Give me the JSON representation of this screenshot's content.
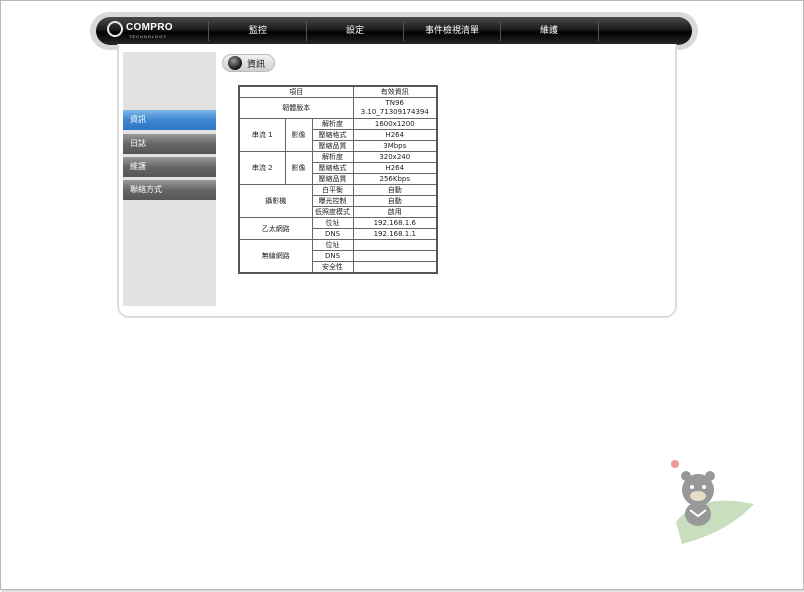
{
  "brand": {
    "name": "COMPRO",
    "sub": "TECHNOLOGY"
  },
  "nav": {
    "items": [
      "監控",
      "設定",
      "事件檢視清單",
      "維護"
    ]
  },
  "sidebar": {
    "items": [
      {
        "label": "資訊",
        "active": true
      },
      {
        "label": "日誌",
        "active": false
      },
      {
        "label": "維護",
        "active": false
      },
      {
        "label": "聯絡方式",
        "active": false
      }
    ]
  },
  "section": {
    "title": "資訊"
  },
  "table": {
    "headers": {
      "item": "項目",
      "value": "有效資訊"
    },
    "firmware": {
      "label": "韌體版本",
      "value_line1": "TN96",
      "value_line2": "3.10_71309174394"
    },
    "stream1": {
      "label": "串流 1",
      "group": "影像",
      "rows": [
        {
          "label": "解析度",
          "value": "1600x1200"
        },
        {
          "label": "壓縮格式",
          "value": "H264"
        },
        {
          "label": "壓縮品質",
          "value": "3Mbps"
        }
      ]
    },
    "stream2": {
      "label": "串流 2",
      "group": "影像",
      "rows": [
        {
          "label": "解析度",
          "value": "320x240"
        },
        {
          "label": "壓縮格式",
          "value": "H264"
        },
        {
          "label": "壓縮品質",
          "value": "256Kbps"
        }
      ]
    },
    "camera": {
      "label": "攝影機",
      "rows": [
        {
          "label": "白平衡",
          "value": "自動"
        },
        {
          "label": "曝光控制",
          "value": "自動"
        },
        {
          "label": "低照度模式",
          "value": "啟用"
        }
      ]
    },
    "ethernet": {
      "label": "乙太網路",
      "rows": [
        {
          "label": "位址",
          "value": "192.168.1.6"
        },
        {
          "label": "DNS",
          "value": "192.168.1.1"
        }
      ]
    },
    "wireless": {
      "label": "無線網路",
      "rows": [
        {
          "label": "位址",
          "value": ""
        },
        {
          "label": "DNS",
          "value": ""
        },
        {
          "label": "安全性",
          "value": ""
        }
      ]
    }
  },
  "colors": {
    "nav_bg": "#111111",
    "active_item": "#3d86d2",
    "inactive_item": "#666666"
  }
}
